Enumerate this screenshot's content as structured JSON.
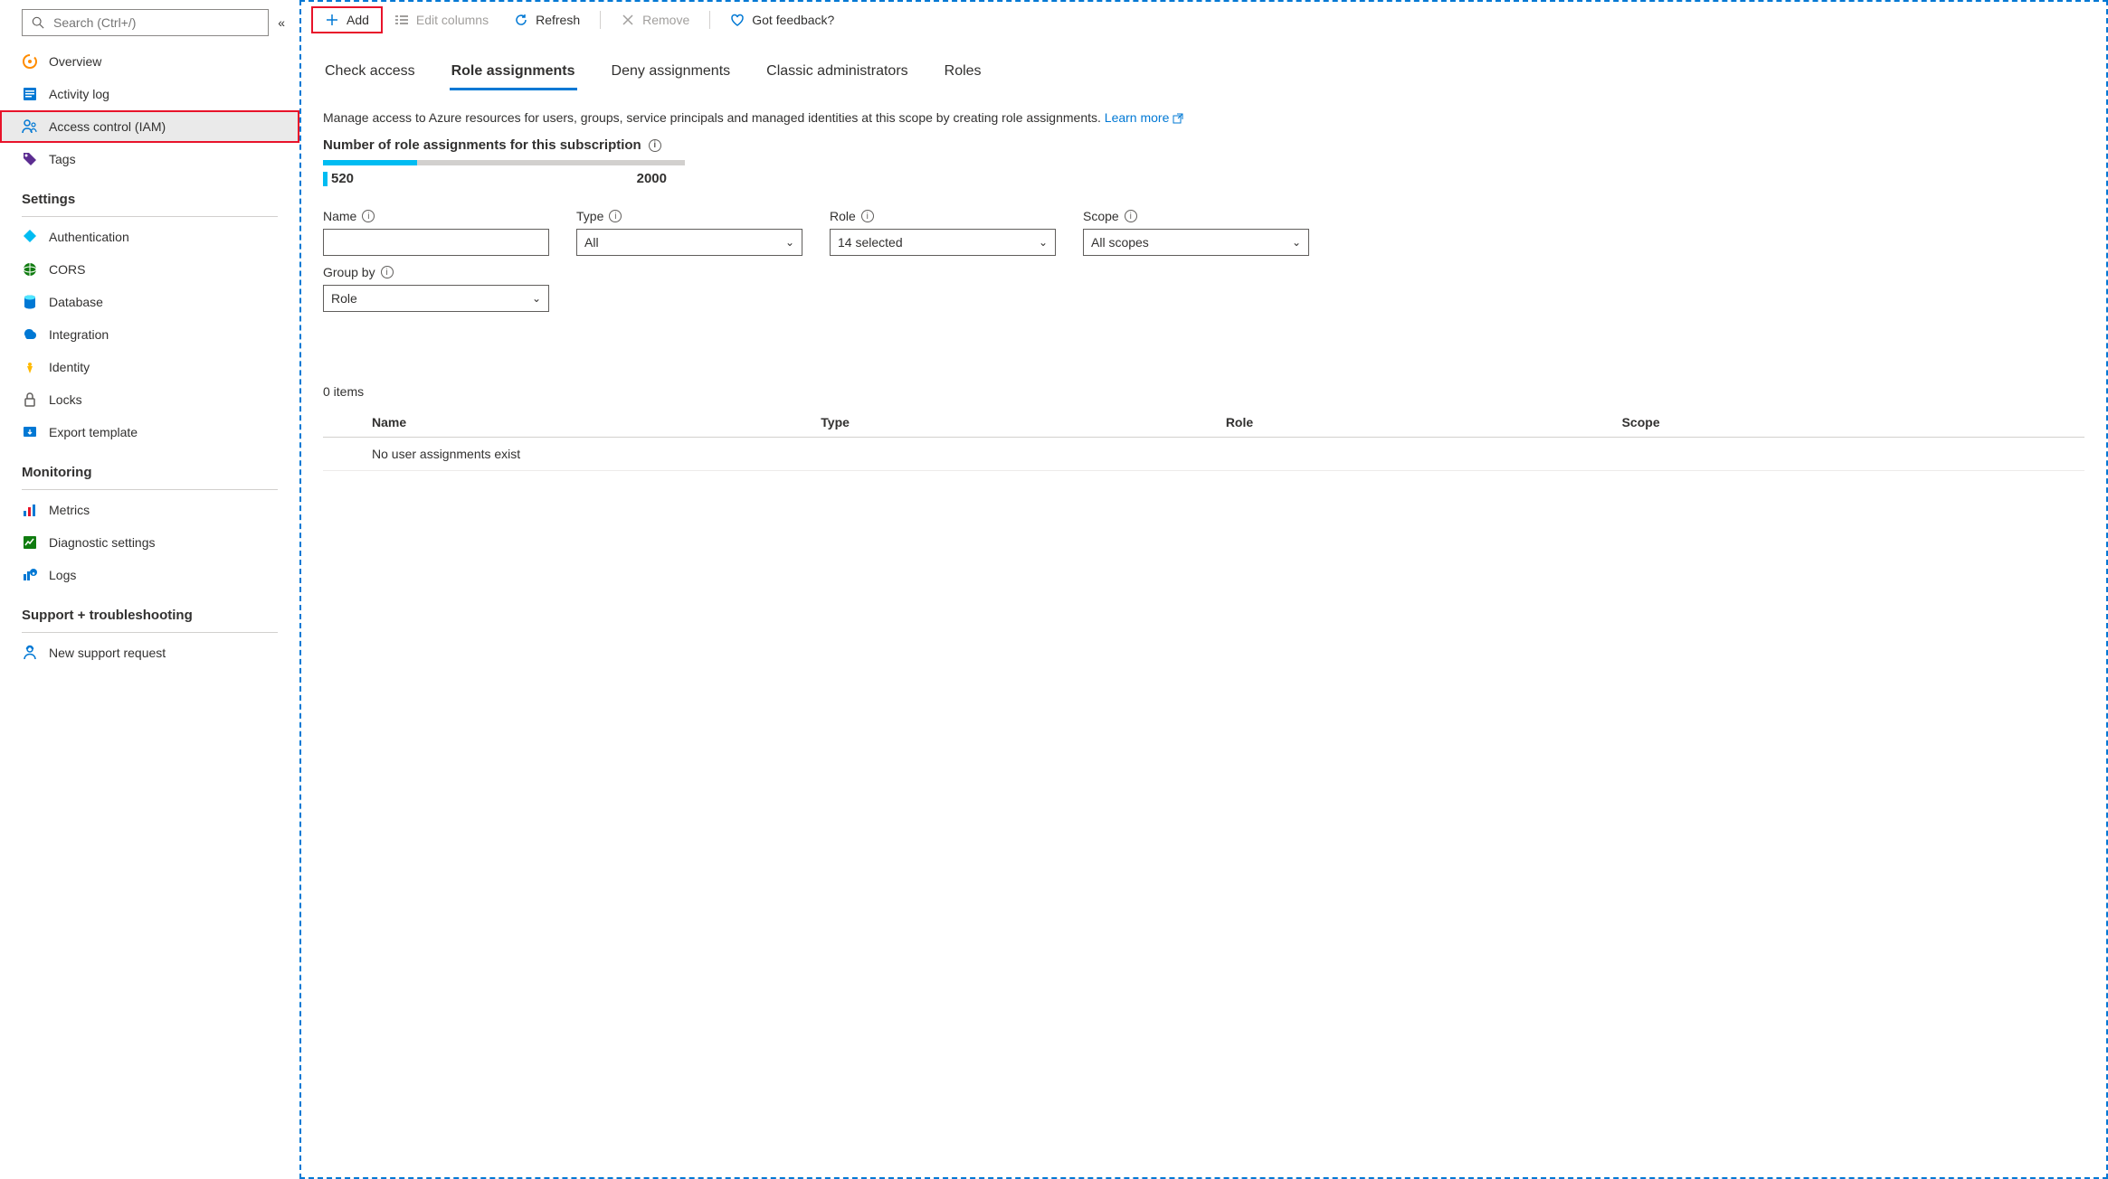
{
  "sidebar": {
    "search_placeholder": "Search (Ctrl+/)",
    "items": [
      {
        "label": "Overview",
        "icon": "overview-icon"
      },
      {
        "label": "Activity log",
        "icon": "activity-log-icon"
      },
      {
        "label": "Access control (IAM)",
        "icon": "access-control-icon",
        "active": true
      },
      {
        "label": "Tags",
        "icon": "tags-icon"
      }
    ],
    "sections": [
      {
        "header": "Settings",
        "items": [
          {
            "label": "Authentication",
            "icon": "authentication-icon"
          },
          {
            "label": "CORS",
            "icon": "cors-icon"
          },
          {
            "label": "Database",
            "icon": "database-icon"
          },
          {
            "label": "Integration",
            "icon": "integration-icon"
          },
          {
            "label": "Identity",
            "icon": "identity-icon"
          },
          {
            "label": "Locks",
            "icon": "locks-icon"
          },
          {
            "label": "Export template",
            "icon": "export-template-icon"
          }
        ]
      },
      {
        "header": "Monitoring",
        "items": [
          {
            "label": "Metrics",
            "icon": "metrics-icon"
          },
          {
            "label": "Diagnostic settings",
            "icon": "diagnostic-icon"
          },
          {
            "label": "Logs",
            "icon": "logs-icon"
          }
        ]
      },
      {
        "header": "Support + troubleshooting",
        "items": [
          {
            "label": "New support request",
            "icon": "support-icon"
          }
        ]
      }
    ]
  },
  "toolbar": {
    "add": "Add",
    "edit_columns": "Edit columns",
    "refresh": "Refresh",
    "remove": "Remove",
    "feedback": "Got feedback?"
  },
  "tabs": [
    "Check access",
    "Role assignments",
    "Deny assignments",
    "Classic administrators",
    "Roles"
  ],
  "active_tab": 1,
  "description": "Manage access to Azure resources for users, groups, service principals and managed identities at this scope by creating role assignments.",
  "learn_more": "Learn more",
  "count_header": "Number of role assignments for this subscription",
  "progress": {
    "current": "520",
    "max": "2000",
    "percent": 26
  },
  "filters": {
    "name_label": "Name",
    "type_label": "Type",
    "type_value": "All",
    "role_label": "Role",
    "role_value": "14 selected",
    "scope_label": "Scope",
    "scope_value": "All scopes",
    "groupby_label": "Group by",
    "groupby_value": "Role"
  },
  "table": {
    "items_count": "0 items",
    "columns": [
      "Name",
      "Type",
      "Role",
      "Scope"
    ],
    "empty_message": "No user assignments exist"
  }
}
